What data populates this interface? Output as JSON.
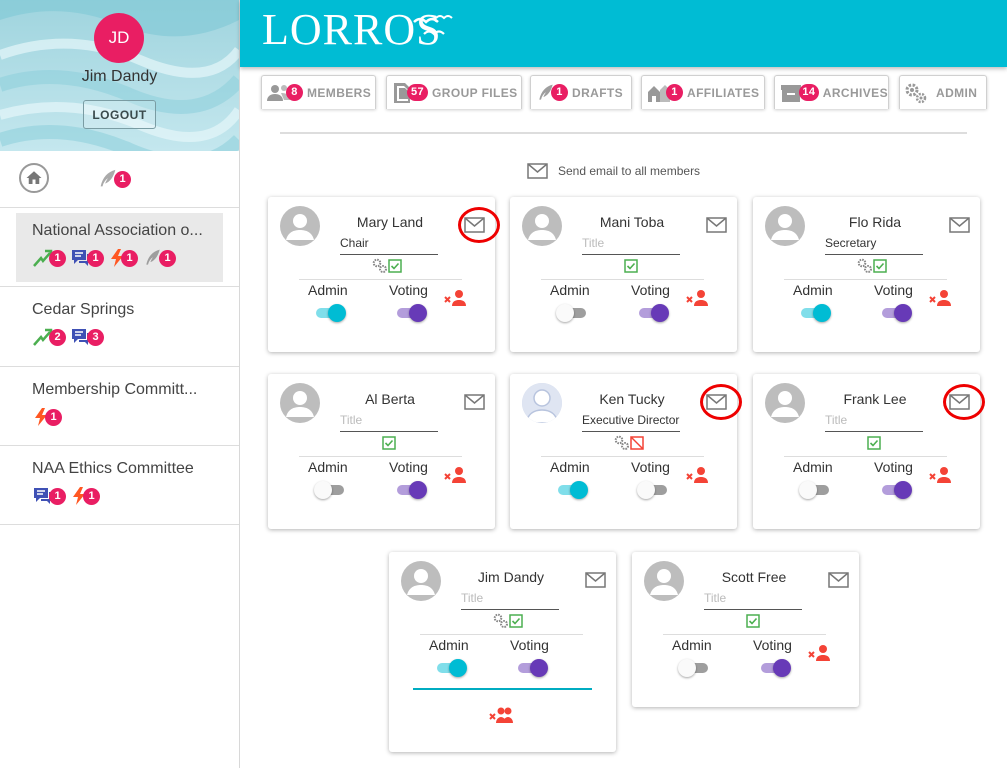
{
  "user": {
    "initials": "JD",
    "name": "Jim Dandy",
    "logout_label": "LOGOUT"
  },
  "quick": {
    "drafts_count": "1"
  },
  "groups": [
    {
      "name": "National Association o...",
      "active": true,
      "icons": [
        {
          "icon": "runner-icon",
          "count": "1"
        },
        {
          "icon": "chat-icon",
          "count": "1"
        },
        {
          "icon": "lightning-icon",
          "count": "1"
        },
        {
          "icon": "quill-icon",
          "count": "1"
        }
      ]
    },
    {
      "name": "Cedar Springs",
      "icons": [
        {
          "icon": "runner-icon",
          "count": "2"
        },
        {
          "icon": "chat-icon",
          "count": "3"
        }
      ]
    },
    {
      "name": "Membership Committ...",
      "icons": [
        {
          "icon": "lightning-icon",
          "count": "1"
        }
      ]
    },
    {
      "name": "NAA Ethics Committee",
      "icons": [
        {
          "icon": "chat-icon",
          "count": "1"
        },
        {
          "icon": "lightning-icon",
          "count": "1"
        }
      ]
    }
  ],
  "header": {
    "logo": "LORROS"
  },
  "tabs": [
    {
      "label": "MEMBERS",
      "count": "8",
      "icon": "members-icon"
    },
    {
      "label": "GROUP FILES",
      "count": "57",
      "icon": "files-icon"
    },
    {
      "label": "DRAFTS",
      "count": "1",
      "icon": "quill-icon"
    },
    {
      "label": "AFFILIATES",
      "count": "1",
      "icon": "affiliates-icon"
    },
    {
      "label": "ARCHIVES",
      "count": "14",
      "icon": "archives-icon"
    },
    {
      "label": "ADMIN",
      "count": "",
      "icon": "gears-icon"
    }
  ],
  "send_all_label": "Send email to all members",
  "members_labels": {
    "admin": "Admin",
    "voting": "Voting",
    "title_placeholder": "Title"
  },
  "members": [
    {
      "name": "Mary Land",
      "title": "Chair",
      "gear": true,
      "perm": "check",
      "admin": true,
      "voting": true,
      "remove": true,
      "highlight_mail": true
    },
    {
      "name": "Mani Toba",
      "title": "",
      "gear": false,
      "perm": "check",
      "admin": false,
      "voting": true,
      "remove": true,
      "highlight_mail": false
    },
    {
      "name": "Flo Rida",
      "title": "Secretary",
      "gear": true,
      "perm": "check",
      "admin": true,
      "voting": true,
      "remove": true,
      "highlight_mail": false
    },
    {
      "name": "Al Berta",
      "title": "",
      "gear": false,
      "perm": "check",
      "admin": false,
      "voting": true,
      "remove": true,
      "highlight_mail": false
    },
    {
      "name": "Ken Tucky",
      "title": "Executive Director",
      "gear": true,
      "perm": "blocked",
      "admin": true,
      "voting": false,
      "remove": true,
      "highlight_mail": true,
      "photo": true
    },
    {
      "name": "Frank Lee",
      "title": "",
      "gear": false,
      "perm": "check",
      "admin": false,
      "voting": true,
      "remove": true,
      "highlight_mail": true
    },
    {
      "name": "Jim Dandy",
      "title": "",
      "gear": true,
      "perm": "check",
      "admin": true,
      "voting": true,
      "remove": true,
      "highlight_mail": false,
      "self": true
    },
    {
      "name": "Scott Free",
      "title": "",
      "gear": false,
      "perm": "check",
      "admin": false,
      "voting": true,
      "remove": true,
      "highlight_mail": false
    }
  ],
  "colors": {
    "header": "#00bcd4",
    "badge": "#e91e63",
    "admin_toggle": "#00bcd4",
    "voting_toggle": "#673ab7",
    "remove_icon": "#f44336",
    "check": "#4caf50",
    "highlight": "#ee0000"
  }
}
